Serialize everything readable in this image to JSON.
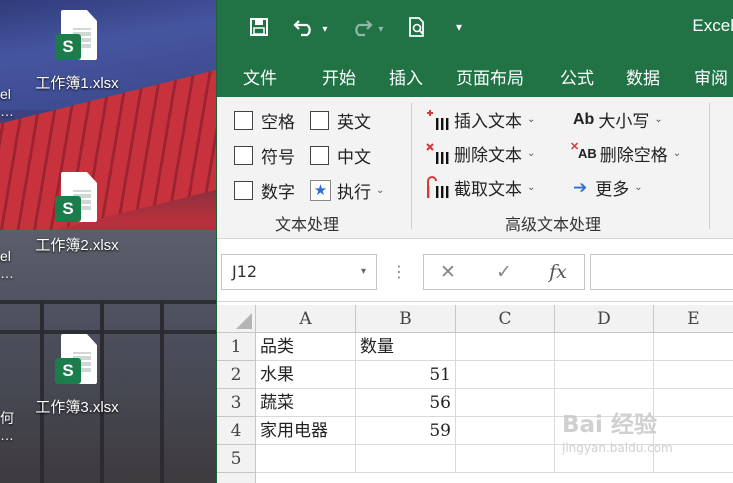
{
  "desktop": {
    "files": [
      {
        "badge": "S",
        "label": "工作簿1.xlsx"
      },
      {
        "badge": "S",
        "label": "工作簿2.xlsx"
      },
      {
        "badge": "S",
        "label": "工作簿3.xlsx"
      }
    ],
    "cut_off_left": [
      {
        "line1": "el",
        "line2": "…"
      },
      {
        "line1": "el",
        "line2": "…"
      },
      {
        "line1": "何",
        "line2": "…"
      }
    ]
  },
  "window": {
    "app_title": "Excel",
    "quick_access": {
      "more": "▾"
    }
  },
  "ribbon_tabs": [
    "文件",
    "开始",
    "插入",
    "页面布局",
    "公式",
    "数据",
    "审阅"
  ],
  "ribbon": {
    "checkboxes_col1": [
      "空格",
      "符号",
      "数字"
    ],
    "checkboxes_col2": [
      "英文",
      "中文"
    ],
    "execute_label": "执行",
    "group1_label": "文本处理",
    "commands_col1": [
      "插入文本",
      "删除文本",
      "截取文本"
    ],
    "commands_col2": [
      "大小写",
      "删除空格",
      "更多"
    ],
    "icon_text": {
      "case": "Ab",
      "trim": "AB"
    },
    "group2_label": "高级文本处理"
  },
  "formula_bar": {
    "name_box": "J12",
    "cancel": "✕",
    "enter": "✓",
    "fx": "fx",
    "formula": ""
  },
  "sheet": {
    "columns": [
      "A",
      "B",
      "C",
      "D",
      "E"
    ],
    "rows": [
      {
        "num": "1",
        "a": "品类",
        "b": "数量"
      },
      {
        "num": "2",
        "a": "水果",
        "b": "51"
      },
      {
        "num": "3",
        "a": "蔬菜",
        "b": "56"
      },
      {
        "num": "4",
        "a": "家用电器",
        "b": "59"
      },
      {
        "num": "5",
        "a": "",
        "b": ""
      }
    ]
  },
  "watermark": {
    "main": "Bai 经验",
    "sub": "jingyan.baidu.com"
  },
  "colors": {
    "excel_green": "#217346",
    "ribbon_bg": "#f3f3f3",
    "red_icon": "#d63a3a",
    "blue_icon": "#2e6fd1"
  }
}
